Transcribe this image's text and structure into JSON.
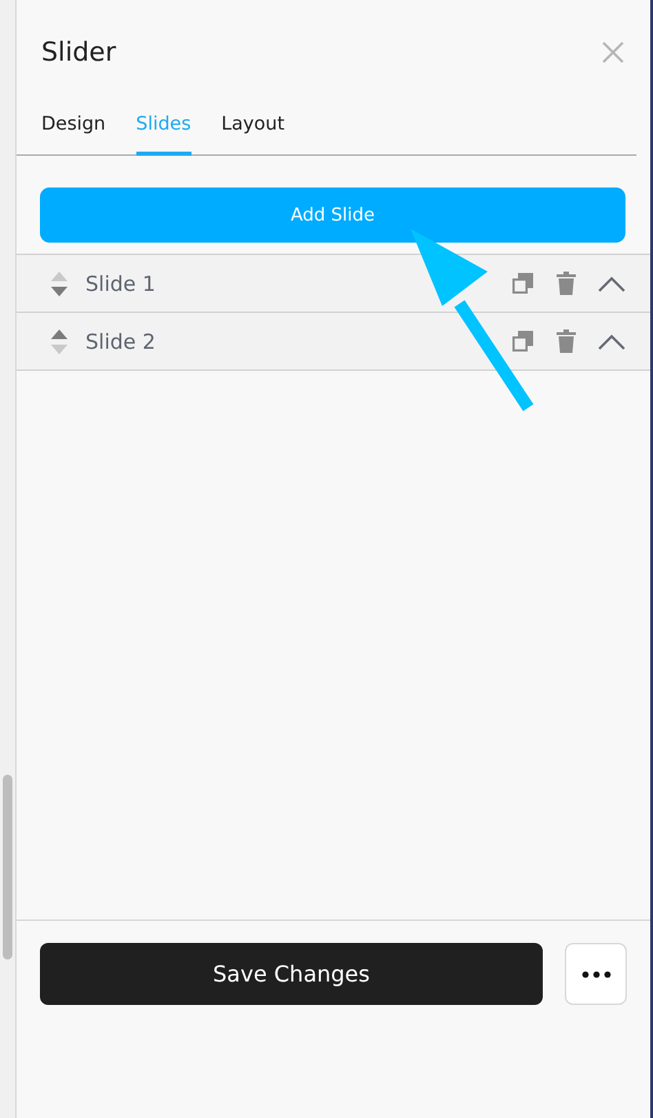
{
  "panel": {
    "title": "Slider"
  },
  "tabs": [
    {
      "label": "Design",
      "selected": false
    },
    {
      "label": "Slides",
      "selected": true
    },
    {
      "label": "Layout",
      "selected": false
    }
  ],
  "add_button": "Add Slide",
  "slides": [
    {
      "name": "Slide 1",
      "can_move_up": false,
      "can_move_down": true
    },
    {
      "name": "Slide 2",
      "can_move_up": true,
      "can_move_down": false
    }
  ],
  "save_button": "Save Changes"
}
